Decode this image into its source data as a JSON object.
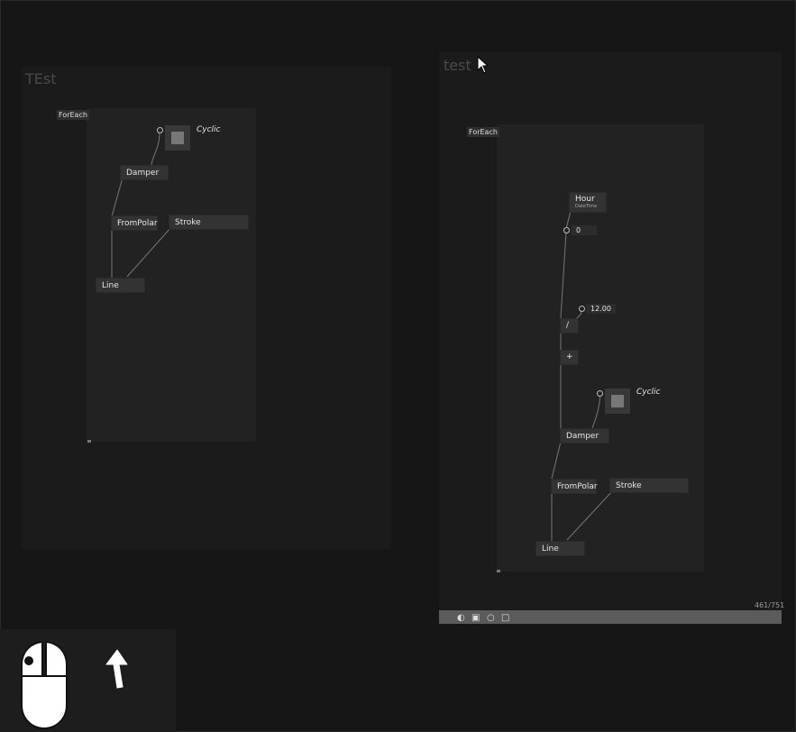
{
  "windows": [
    {
      "title": "TEst",
      "foreach_label": "ForEach",
      "nodes": {
        "damper": "Damper",
        "frompolar": "FromPolar",
        "stroke": "Stroke",
        "line": "Line"
      },
      "cyclic_label": "Cyclic"
    },
    {
      "title": "test",
      "foreach_label": "ForEach",
      "nodes": {
        "hour": "Hour",
        "hour_sub": "DateTime",
        "zero": "0",
        "twelve": "12.00",
        "divide": "/",
        "plus": "+",
        "damper": "Damper",
        "frompolar": "FromPolar",
        "stroke": "Stroke",
        "line": "Line"
      },
      "cyclic_label": "Cyclic",
      "counter": "461/751",
      "bottom_icons": [
        "palette-icon",
        "camera-icon",
        "circle-icon",
        "square-icon"
      ]
    }
  ],
  "overlay": {
    "icons": [
      "mouse-left-click-icon",
      "arrow-up-icon"
    ]
  }
}
